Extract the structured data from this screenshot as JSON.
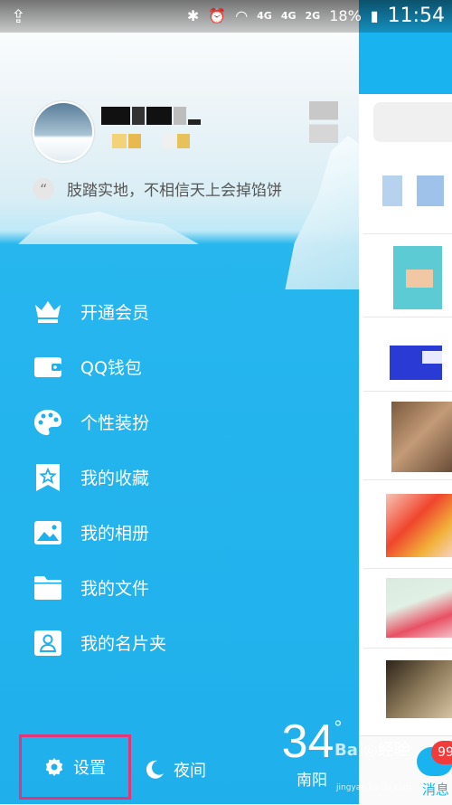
{
  "status_bar": {
    "network_4g": "4G",
    "network_4g_small": "4G",
    "network_2g": "2G",
    "battery": "18%",
    "time": "11:54"
  },
  "profile": {
    "signature": "肢踏实地，不相信天上会掉馅饼",
    "quote_glyph": "“"
  },
  "menu": [
    {
      "label": "开通会员",
      "icon": "crown-icon"
    },
    {
      "label": "QQ钱包",
      "icon": "wallet-icon"
    },
    {
      "label": "个性装扮",
      "icon": "palette-icon"
    },
    {
      "label": "我的收藏",
      "icon": "bookmark-star-icon"
    },
    {
      "label": "我的相册",
      "icon": "photo-icon"
    },
    {
      "label": "我的文件",
      "icon": "folder-icon"
    },
    {
      "label": "我的名片夹",
      "icon": "contact-card-icon"
    }
  ],
  "bottom": {
    "settings_label": "设置",
    "night_label": "夜间",
    "temperature": "34",
    "degree": "°",
    "city": "南阳"
  },
  "right_pane": {
    "badge_count": "99",
    "tab_label": "消息"
  },
  "watermark": {
    "text": "Bai◎经验",
    "url": "jingyan.baidu.com"
  },
  "colors": {
    "accent_blue": "#19b4ef",
    "highlight_box": "#e53579",
    "badge_red": "#f23b3b"
  }
}
